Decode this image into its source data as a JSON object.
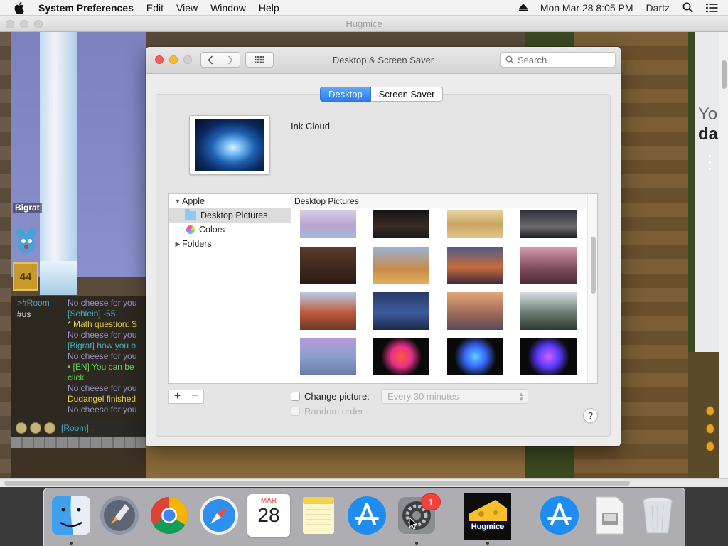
{
  "menubar": {
    "app": "System Preferences",
    "items": [
      "Edit",
      "View",
      "Window",
      "Help"
    ],
    "datetime": "Mon Mar 28  8:05 PM",
    "user": "Dartz"
  },
  "game_window": {
    "title": "Hugmice",
    "player_name": "Bigrat",
    "level": "44",
    "chat": {
      "channel": ">#Room",
      "channel_sub": "#us",
      "lines": [
        {
          "text": "No cheese for you",
          "color": "gray"
        },
        {
          "text": "[Sehlein] -55",
          "color": "teal"
        },
        {
          "text": "* Math question: S",
          "color": "yellow"
        },
        {
          "text": "No cheese for you",
          "color": "gray"
        },
        {
          "text": "[Bigrat] how you b",
          "color": "teal"
        },
        {
          "text": "No cheese for you",
          "color": "gray"
        },
        {
          "text": "• [EN] You can be",
          "color": "green"
        },
        {
          "text": "click",
          "color": "green"
        },
        {
          "text": "No cheese for you",
          "color": "gray"
        },
        {
          "text": "Dudangel finished",
          "color": "yellow"
        },
        {
          "text": "No cheese for you",
          "color": "gray"
        }
      ],
      "input_label": "[Room] :"
    },
    "side_text": "Yo",
    "side_text2": "da"
  },
  "prefs_window": {
    "title": "Desktop & Screen Saver",
    "search_placeholder": "Search",
    "tabs": [
      {
        "label": "Desktop",
        "active": true
      },
      {
        "label": "Screen Saver",
        "active": false
      }
    ],
    "current_wallpaper": "Ink Cloud",
    "source_list": {
      "group": "Apple",
      "items": [
        {
          "label": "Desktop Pictures",
          "selected": true
        },
        {
          "label": "Colors",
          "selected": false
        }
      ],
      "folders": "Folders"
    },
    "gallery_header": "Desktop Pictures",
    "add_label": "+",
    "remove_label": "−",
    "change_picture_label": "Change picture:",
    "interval_value": "Every 30 minutes",
    "random_order_label": "Random order",
    "help_label": "?"
  },
  "dock": {
    "apps": [
      "finder-icon",
      "launchpad-icon",
      "chrome-icon",
      "safari-icon",
      "calendar-icon",
      "notes-icon",
      "app-store-icon",
      "system-preferences-icon",
      "hugmice-icon",
      "app-store-download-icon",
      "disk-image-icon",
      "trash-icon"
    ],
    "calendar_month": "MAR",
    "calendar_day": "28",
    "sysprefs_badge": "1",
    "hugmice_label": "Hugmice"
  },
  "colors": {
    "accent": "#2b7de9",
    "badge": "#f4423c"
  }
}
